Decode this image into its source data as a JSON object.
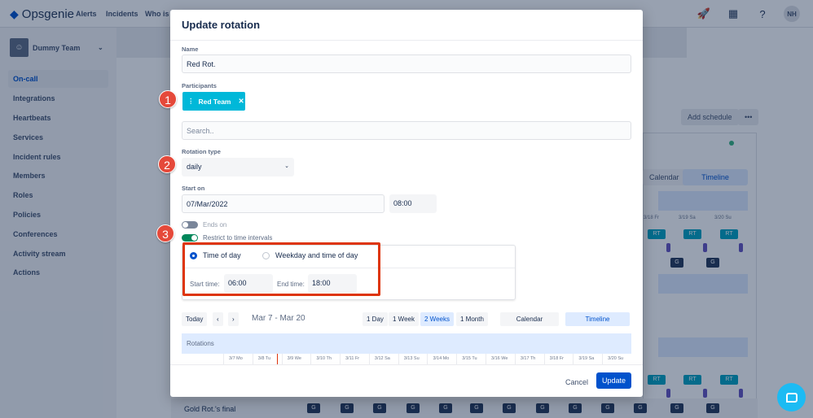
{
  "topbar": {
    "brand": "Opsgenie",
    "nav": [
      "Alerts",
      "Incidents",
      "Who is"
    ],
    "avatar": "NH"
  },
  "sidebar": {
    "team": "Dummy Team",
    "items": [
      "On-call",
      "Integrations",
      "Heartbeats",
      "Services",
      "Incident rules",
      "Members",
      "Roles",
      "Policies",
      "Conferences",
      "Activity stream",
      "Actions"
    ]
  },
  "background": {
    "add_schedule": "Add schedule",
    "more": "•••",
    "calendar": "Calendar",
    "timeline": "Timeline",
    "dates": [
      "3/18 Fr",
      "3/19 Sa",
      "3/20 Su"
    ],
    "rt": "RT",
    "g": "G",
    "gold_row": "Gold Rot.'s final"
  },
  "modal": {
    "title": "Update rotation",
    "name_label": "Name",
    "name_value": "Red Rot.",
    "participants_label": "Participants",
    "participant_chip": "Red Team",
    "search_placeholder": "Search..",
    "rotation_type_label": "Rotation type",
    "rotation_type_value": "daily",
    "start_on_label": "Start on",
    "start_date": "07/Mar/2022",
    "start_time": "08:00",
    "ends_on_label": "Ends on",
    "restrict_label": "Restrict to time intervals",
    "ends_on_enabled": false,
    "restrict_enabled": true,
    "interval_options": [
      "Time of day",
      "Weekday and time of day"
    ],
    "interval_selected": "Time of day",
    "start_time_label": "Start time:",
    "interval_start": "06:00",
    "end_time_label": "End time:",
    "interval_end": "18:00",
    "timeline": {
      "today": "Today",
      "prev": "‹",
      "next": "›",
      "range": "Mar 7 - Mar 20",
      "ranges": [
        "1 Day",
        "1 Week",
        "2 Weeks",
        "1 Month"
      ],
      "selected_range": "2 Weeks",
      "views": [
        "Calendar",
        "Timeline"
      ],
      "selected_view": "Timeline",
      "rotations_label": "Rotations",
      "dates": [
        "3/7 Mo",
        "3/8 Tu",
        "3/9 We",
        "3/10 Th",
        "3/11 Fr",
        "3/12 Sa",
        "3/13 Su",
        "3/14 Mo",
        "3/15 Tu",
        "3/16 We",
        "3/17 Th",
        "3/18 Fr",
        "3/19 Sa",
        "3/20 Su"
      ]
    },
    "cancel": "Cancel",
    "update": "Update"
  },
  "annotations": [
    "1",
    "2",
    "3"
  ],
  "colors": {
    "accent": "#0052cc",
    "chip": "#00b8d9",
    "annotation": "#e5493a",
    "highlight": "#de350b"
  }
}
